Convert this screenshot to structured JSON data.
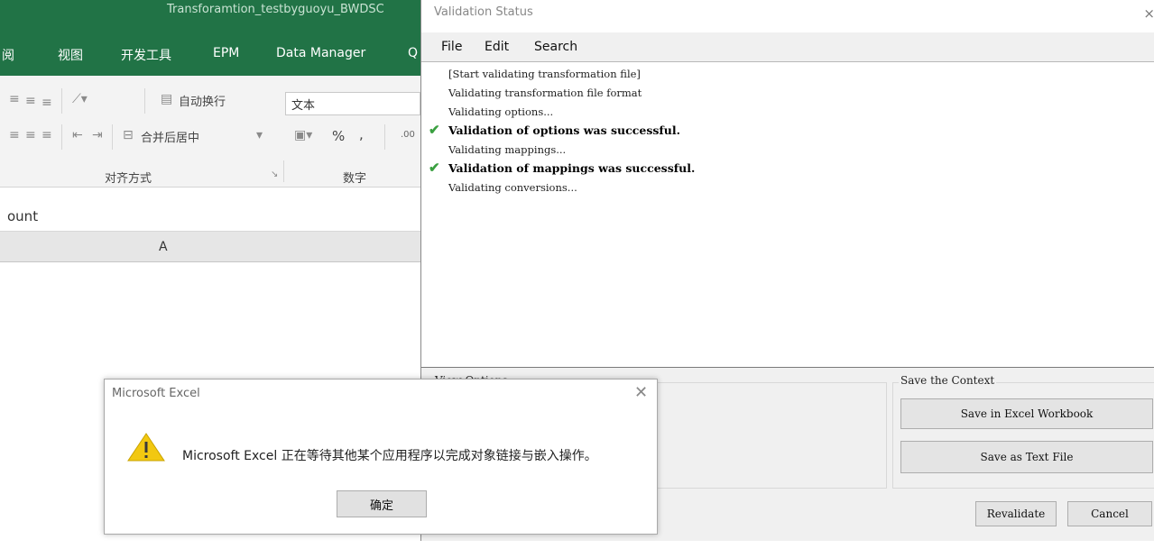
{
  "excel": {
    "window_title": "Transforamtion_testbyguoyu_BWDSC",
    "tabs": [
      "阅",
      "视图",
      "开发工具",
      "EPM",
      "Data Manager",
      "Q"
    ],
    "ribbon": {
      "wrap_text": "自动换行",
      "merge_center": "合并后居中",
      "number_format_value": "文本",
      "percent": "%",
      "comma": ",",
      "decimals": ".00",
      "group_alignment": "对齐方式",
      "group_number": "数字"
    },
    "formula_text": "ount",
    "column_header": "A"
  },
  "validation": {
    "title": "Validation Status",
    "close": "×",
    "menu": [
      "File",
      "Edit",
      "Search"
    ],
    "log": [
      {
        "text": "[Start validating transformation file]",
        "bold": false,
        "check": false
      },
      {
        "text": "Validating transformation file format",
        "bold": false,
        "check": false
      },
      {
        "text": "Validating options...",
        "bold": false,
        "check": false
      },
      {
        "text": "Validation of options was successful.",
        "bold": true,
        "check": true
      },
      {
        "text": "Validating mappings...",
        "bold": false,
        "check": false
      },
      {
        "text": "Validation of mappings was successful.",
        "bold": true,
        "check": true
      },
      {
        "text": "Validating conversions...",
        "bold": false,
        "check": false
      }
    ],
    "view_options_partial": "View Options",
    "save_context_label": "Save the Context",
    "save_excel": "Save in Excel Workbook",
    "save_text": "Save as Text File",
    "revalidate": "Revalidate",
    "cancel": "Cancel"
  },
  "dialog": {
    "title": "Microsoft Excel",
    "message": "Microsoft Excel 正在等待其他某个应用程序以完成对象链接与嵌入操作。",
    "ok": "确定",
    "icon": "warning-icon",
    "icon_color": "#f2c811"
  }
}
